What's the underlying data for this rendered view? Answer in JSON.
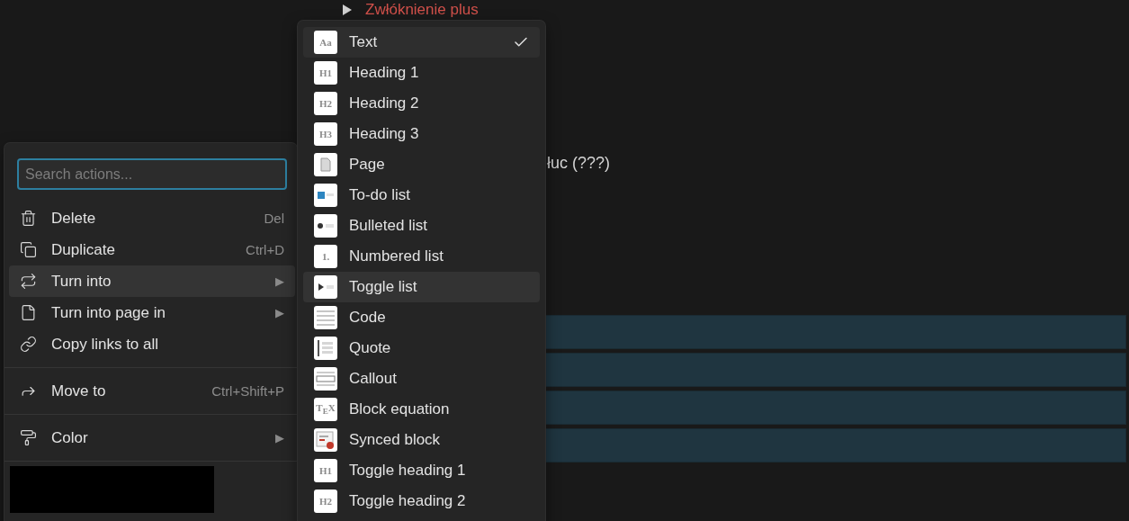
{
  "page": {
    "toggle_heading": "Zwłóknienie plus",
    "partial_text": "łuc (???)",
    "blocks": [
      {
        "selected": true
      },
      {
        "selected": true
      },
      {
        "selected": true
      },
      {
        "selected": true
      }
    ]
  },
  "context_menu": {
    "search": {
      "placeholder": "Search actions..."
    },
    "sections": [
      {
        "items": [
          {
            "label": "Delete",
            "shortcut": "Del",
            "selected": false
          },
          {
            "label": "Duplicate",
            "shortcut": "Ctrl+D",
            "selected": false
          },
          {
            "label": "Turn into",
            "submenu_arrow": "▶",
            "selected": true
          },
          {
            "label": "Turn into page in",
            "submenu_arrow": "▶",
            "selected": false
          },
          {
            "label": "Copy links to all",
            "selected": false
          }
        ]
      },
      {
        "items": [
          {
            "label": "Move to",
            "shortcut": "Ctrl+Shift+P",
            "selected": false
          }
        ]
      },
      {
        "items": [
          {
            "label": "Color",
            "submenu_arrow": "▶",
            "selected": false
          }
        ]
      }
    ],
    "redacted": true
  },
  "turn_into_menu": [
    {
      "label": "Text",
      "badge": "Aa",
      "selected": true,
      "hovered": false
    },
    {
      "label": "Heading 1",
      "badge": "H1",
      "selected": false,
      "hovered": false
    },
    {
      "label": "Heading 2",
      "badge": "H2",
      "selected": false,
      "hovered": false
    },
    {
      "label": "Heading 3",
      "badge": "H3",
      "selected": false,
      "hovered": false
    },
    {
      "label": "Page",
      "selected": false,
      "hovered": false
    },
    {
      "label": "To-do list",
      "selected": false,
      "hovered": false
    },
    {
      "label": "Bulleted list",
      "selected": false,
      "hovered": false
    },
    {
      "label": "Numbered list",
      "badge": "1.",
      "selected": false,
      "hovered": false
    },
    {
      "label": "Toggle list",
      "selected": false,
      "hovered": true
    },
    {
      "label": "Code",
      "selected": false,
      "hovered": false
    },
    {
      "label": "Quote",
      "selected": false,
      "hovered": false
    },
    {
      "label": "Callout",
      "selected": false,
      "hovered": false
    },
    {
      "label": "Block equation",
      "badge": "T$_{E}$X",
      "selected": false,
      "hovered": false
    },
    {
      "label": "Synced block",
      "selected": false,
      "hovered": false
    },
    {
      "label": "Toggle heading 1",
      "badge": "H1",
      "selected": false,
      "hovered": false
    },
    {
      "label": "Toggle heading 2",
      "badge": "H2",
      "selected": false,
      "hovered": false
    }
  ]
}
